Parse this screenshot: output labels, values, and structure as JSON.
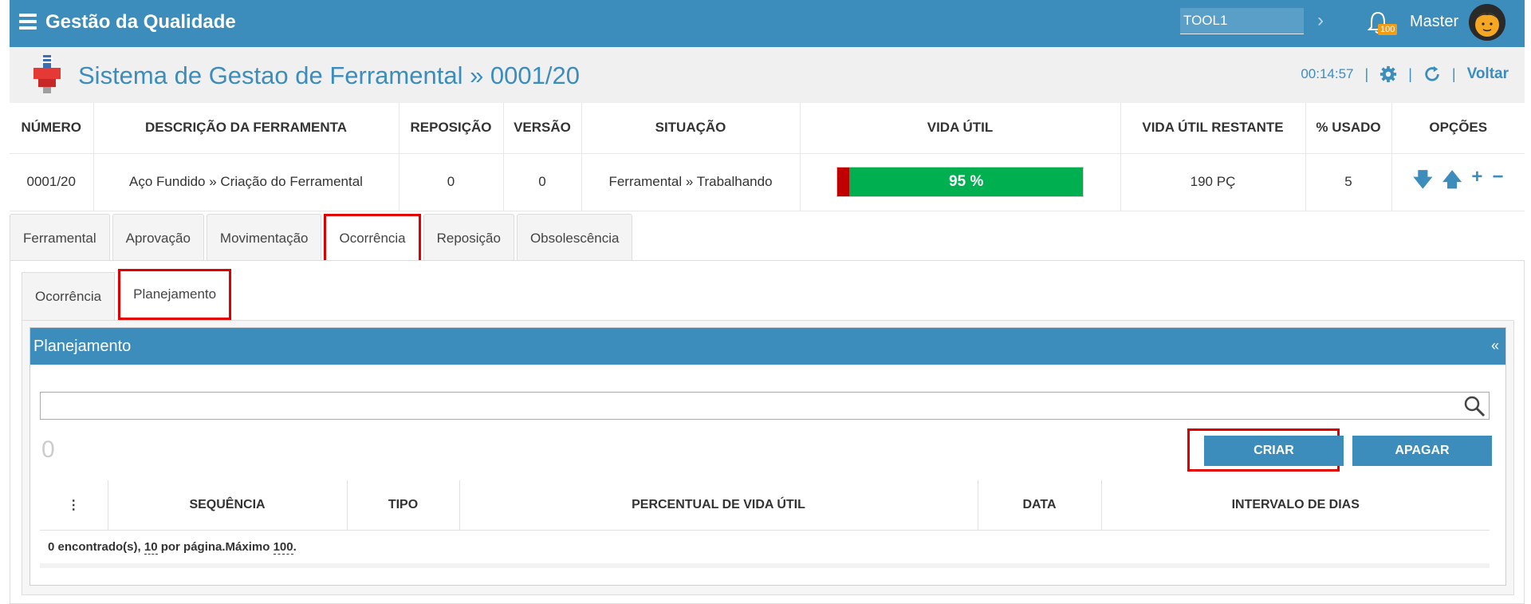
{
  "topbar": {
    "app_title": "Gestão da Qualidade",
    "tool_input_value": "TOOL1",
    "notification_count": "100",
    "user_name": "Master"
  },
  "header": {
    "title": "Sistema de Gestao de Ferramental » 0001/20",
    "timer": "00:14:57",
    "back_label": "Voltar"
  },
  "summary": {
    "columns": [
      "NÚMERO",
      "DESCRIÇÃO DA FERRAMENTA",
      "REPOSIÇÃO",
      "VERSÃO",
      "SITUAÇÃO",
      "VIDA ÚTIL",
      "VIDA ÚTIL RESTANTE",
      "% USADO",
      "OPÇÕES"
    ],
    "row": {
      "numero": "0001/20",
      "descricao": "Aço Fundido » Criação do Ferramental",
      "reposicao": "0",
      "versao": "0",
      "situacao": "Ferramental » Trabalhando",
      "vida_util_label": "95 %",
      "vida_util_remaining_fraction": 0.95,
      "vida_util_restante": "190 PÇ",
      "usado": "5"
    },
    "colors": {
      "used": "#c00000",
      "remaining": "#00b050"
    }
  },
  "tabs": [
    "Ferramental",
    "Aprovação",
    "Movimentação",
    "Ocorrência",
    "Reposição",
    "Obsolescência"
  ],
  "active_tab": "Ocorrência",
  "subtabs": [
    "Ocorrência",
    "Planejamento"
  ],
  "active_subtab": "Planejamento",
  "panel": {
    "title": "Planejamento",
    "collapse_symbol": "«",
    "search_value": "",
    "count": "0",
    "create_label": "CRIAR",
    "delete_label": "APAGAR",
    "grid_columns": [
      "SEQUÊNCIA",
      "TIPO",
      "PERCENTUAL DE VIDA ÚTIL",
      "DATA",
      "INTERVALO DE DIAS"
    ],
    "footer": {
      "found": "0 encontrado(s),",
      "per_page_value": "10",
      "per_page_label": "por página.Máximo",
      "max_value": "100",
      "end": "."
    }
  },
  "accent_color": "#3c8dbc"
}
